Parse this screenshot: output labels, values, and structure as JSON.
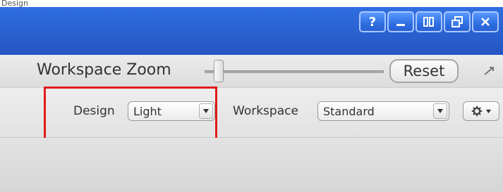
{
  "window": {
    "top_label": "Design",
    "controls": [
      "?",
      "minimize",
      "split-view",
      "restore",
      "close"
    ],
    "control_labels": {
      "help": "?"
    },
    "accent_color": "#2a60d0"
  },
  "toolbar": {
    "workspace_zoom_label": "Workspace Zoom",
    "zoom_level": 0.08,
    "reset_label": "Reset"
  },
  "design_bar": {
    "design_label": "Design",
    "design_value": "Light",
    "workspace_label": "Workspace",
    "workspace_value": "Standard",
    "gear_icon": "gear-icon"
  },
  "highlight": {
    "color": "#e21b1b"
  }
}
